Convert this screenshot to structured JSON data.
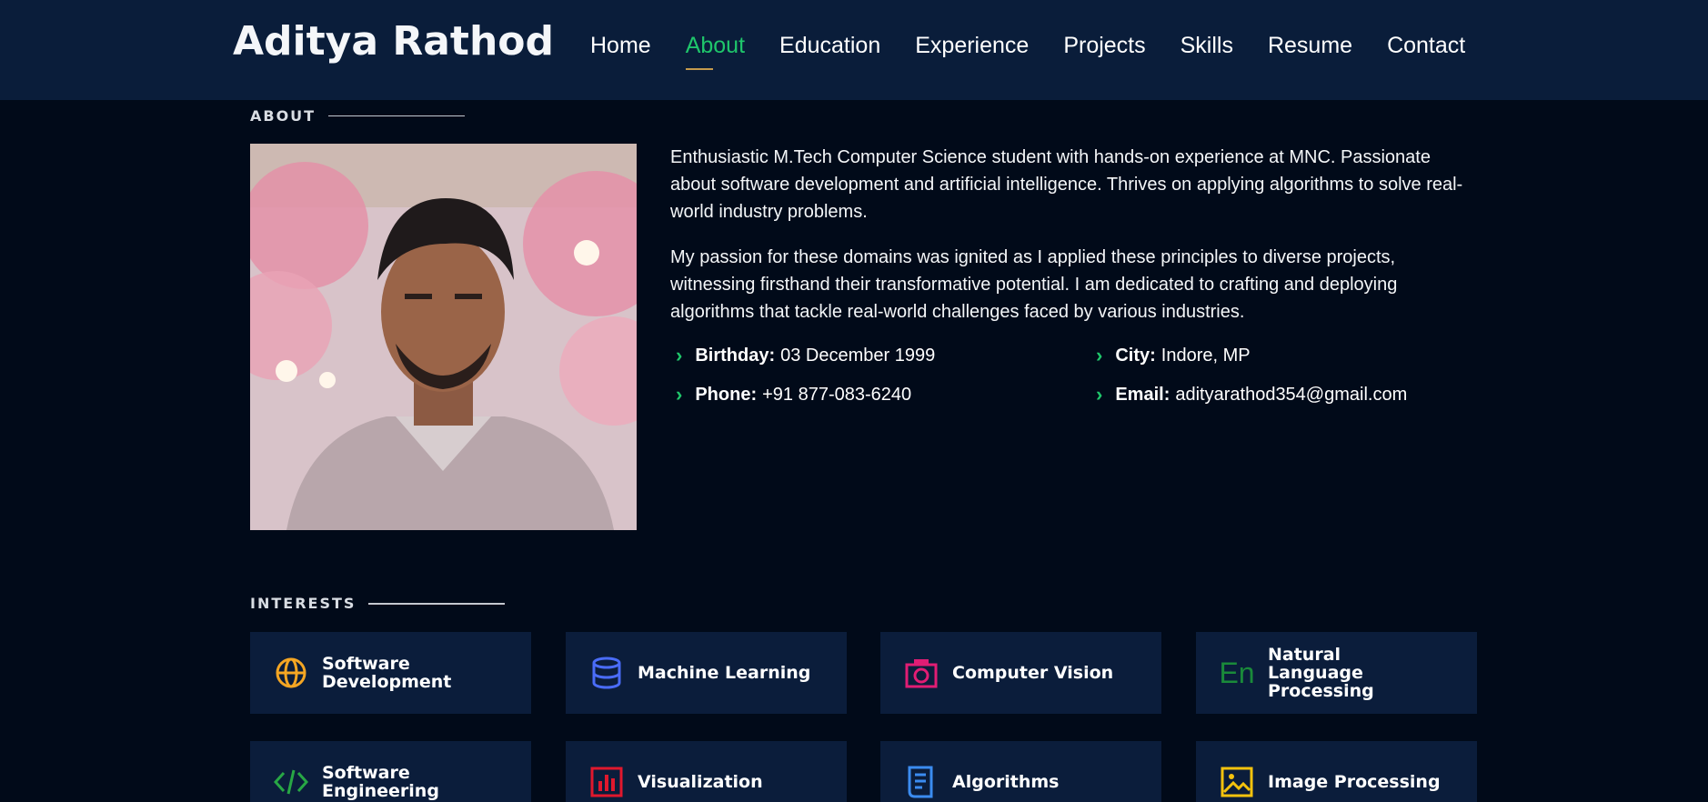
{
  "header": {
    "logo": "Aditya Rathod",
    "nav": [
      "Home",
      "About",
      "Education",
      "Experience",
      "Projects",
      "Skills",
      "Resume",
      "Contact"
    ],
    "active_nav": "About"
  },
  "about": {
    "section_title": "ABOUT",
    "paragraphs": [
      "Enthusiastic M.Tech Computer Science student with hands-on experience at MNC. Passionate about software development and artificial intelligence. Thrives on applying algorithms to solve real-world industry problems.",
      "My passion for these domains was ignited as I applied these principles to diverse projects, witnessing firsthand their transformative potential. I am dedicated to crafting and deploying algorithms that tackle real-world challenges faced by various industries."
    ],
    "facts": [
      {
        "label": "Birthday:",
        "value": "03 December 1999"
      },
      {
        "label": "City:",
        "value": "Indore, MP"
      },
      {
        "label": "Phone:",
        "value": "+91 877-083-6240"
      },
      {
        "label": "Email:",
        "value": "adityarathod354@gmail.com"
      }
    ]
  },
  "interests": {
    "section_title": "INTERESTS",
    "items": [
      {
        "label": "Software Development",
        "icon": "globe-icon",
        "color": "#f5a623"
      },
      {
        "label": "Machine Learning",
        "icon": "database-icon",
        "color": "#4a6cf7"
      },
      {
        "label": "Computer Vision",
        "icon": "camera-icon",
        "color": "#e11d74"
      },
      {
        "label": "Natural Language Processing",
        "icon": "language-icon",
        "color": "#1a8a3a"
      },
      {
        "label": "Software Engineering",
        "icon": "code-icon",
        "color": "#28a745"
      },
      {
        "label": "Visualization",
        "icon": "bar-chart-icon",
        "color": "#e0182d"
      },
      {
        "label": "Algorithms",
        "icon": "document-icon",
        "color": "#3b8cf0"
      },
      {
        "label": "Image Processing",
        "icon": "image-icon",
        "color": "#f4c20d"
      }
    ]
  },
  "colors": {
    "background": "#010a19",
    "header_bg": "#0a1d3a",
    "card_bg": "#0b1d3b",
    "accent_green": "#1fc66b"
  }
}
